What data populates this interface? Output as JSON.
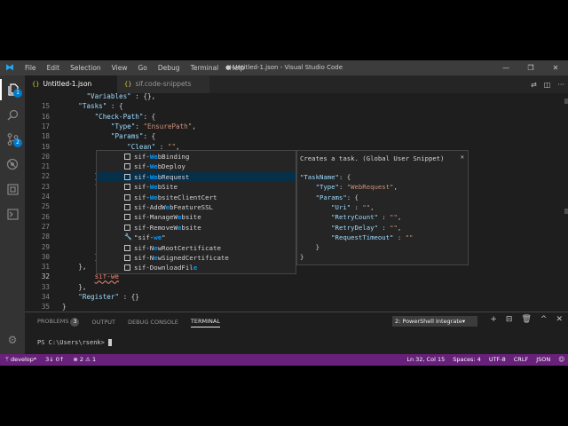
{
  "window": {
    "title": "● Untitled-1.json - Visual Studio Code",
    "menu": [
      "File",
      "Edit",
      "Selection",
      "View",
      "Go",
      "Debug",
      "Terminal",
      "Help"
    ],
    "controls": {
      "minimize": "—",
      "restore": "❐",
      "close": "✕"
    }
  },
  "activity": {
    "explorer_badge": "1",
    "scm_badge": "2"
  },
  "tabs": [
    {
      "icon": "{}",
      "label": "Untitled-1.json",
      "active": true
    },
    {
      "icon": "{}",
      "label": "sif.code-snippets",
      "active": false
    }
  ],
  "editor": {
    "lines": [
      {
        "n": "",
        "text": "      \"Variables\" : {},"
      },
      {
        "n": "15",
        "text": "    \"Tasks\" : {"
      },
      {
        "n": "16",
        "text": "        \"Check-Path\": {"
      },
      {
        "n": "17",
        "text": "            \"Type\": \"EnsurePath\","
      },
      {
        "n": "18",
        "text": "            \"Params\": {"
      },
      {
        "n": "19",
        "text": "                \"Clean\" : \"\","
      },
      {
        "n": "20",
        "text": ""
      },
      {
        "n": "21",
        "text": "            }"
      },
      {
        "n": "22",
        "text": "        },"
      },
      {
        "n": "23",
        "text": "        \"Downl"
      },
      {
        "n": "24",
        "text": "            \"T"
      },
      {
        "n": "25",
        "text": "            \"P"
      },
      {
        "n": "26",
        "text": ""
      },
      {
        "n": "27",
        "text": ""
      },
      {
        "n": "28",
        "text": ""
      },
      {
        "n": "29",
        "text": "            }"
      },
      {
        "n": "30",
        "text": "        },"
      },
      {
        "n": "31",
        "text": "    },"
      },
      {
        "n": "32",
        "text": "        sif-we"
      },
      {
        "n": "33",
        "text": "    },"
      },
      {
        "n": "34",
        "text": "    \"Register\" : {}"
      },
      {
        "n": "35",
        "text": "}"
      }
    ],
    "current_line": "32"
  },
  "suggest": {
    "items": [
      {
        "prefix": "sif-",
        "match": "We",
        "rest": "bBinding",
        "icon": "snippet"
      },
      {
        "prefix": "sif-",
        "match": "We",
        "rest": "bDeploy",
        "icon": "snippet"
      },
      {
        "prefix": "sif-",
        "match": "We",
        "rest": "bRequest",
        "icon": "snippet",
        "selected": true
      },
      {
        "prefix": "sif-",
        "match": "We",
        "rest": "bSite",
        "icon": "snippet"
      },
      {
        "prefix": "sif-",
        "match": "We",
        "rest": "bsiteClientCert",
        "icon": "snippet"
      },
      {
        "prefix": "sif-AddW",
        "match": "e",
        "rest": "bFeatureSSL",
        "icon": "snippet"
      },
      {
        "prefix": "sif-ManageW",
        "match": "e",
        "rest": "bsite",
        "icon": "snippet"
      },
      {
        "prefix": "sif-RemoveW",
        "match": "e",
        "rest": "bsite",
        "icon": "snippet"
      },
      {
        "prefix": "\"sif-",
        "match": "we",
        "rest": "\"",
        "icon": "wrench"
      },
      {
        "prefix": "sif-N",
        "match": "e",
        "rest": "wRootCertificate",
        "icon": "snippet"
      },
      {
        "prefix": "sif-N",
        "match": "e",
        "rest": "wSignedCertificate",
        "icon": "snippet"
      },
      {
        "prefix": "sif-DownloadFil",
        "match": "e",
        "rest": "",
        "icon": "snippet"
      }
    ],
    "details": {
      "header": "Creates a task. (Global User Snippet)",
      "close": "✕",
      "lines": [
        "\"TaskName\": {",
        "    \"Type\": \"WebRequest\",",
        "    \"Params\": {",
        "        \"Uri\" : \"\",",
        "        \"RetryCount\" : \"\",",
        "        \"RetryDelay\" : \"\",",
        "        \"RequestTimeout\" : \"\"",
        "    }",
        "}"
      ]
    }
  },
  "panel": {
    "tabs": [
      "PROBLEMS",
      "OUTPUT",
      "DEBUG CONSOLE",
      "TERMINAL"
    ],
    "problems_count": "3",
    "active_tab": "TERMINAL",
    "terminal_select": "2: PowerShell Integrate▾",
    "actions": [
      "+",
      "⊟",
      "🗑",
      "^",
      "✕"
    ],
    "prompt": "PS C:\\Users\\rsenk>"
  },
  "status": {
    "branch": "develop*",
    "sync": "3↓ 0↑",
    "errors": "2",
    "warnings": "1",
    "position": "Ln 32, Col 15",
    "spaces": "Spaces: 4",
    "encoding": "UTF-8",
    "eol": "CRLF",
    "language": "JSON"
  }
}
